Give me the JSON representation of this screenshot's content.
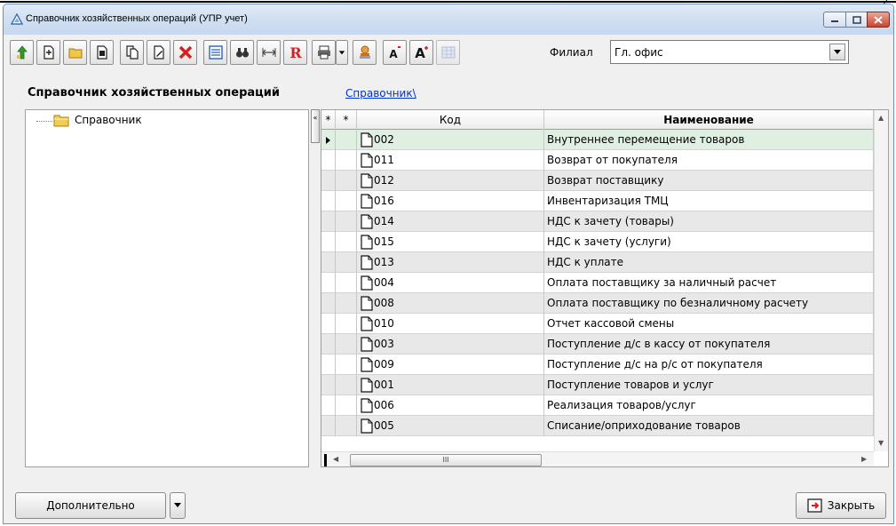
{
  "window": {
    "title": "Справочник хозяйственных операций (УПР учет)",
    "frame_number": "2"
  },
  "toolbar": {
    "buttons": [
      "up-arrow-icon",
      "new-item-icon",
      "new-folder-icon",
      "save-copy-icon",
      "copy-icon",
      "edit-icon",
      "delete-icon",
      "list-icon",
      "binoculars-icon",
      "expand-icon",
      "report-icon",
      "print-icon",
      "dropdown-icon",
      "stamp-icon",
      "font-decrease-icon",
      "font-increase-icon",
      "grid-icon"
    ],
    "filial_label": "Филиал",
    "filial_value": "Гл. офис"
  },
  "header": {
    "title": "Справочник хозяйственных операций",
    "breadcrumb": "Справочник\\"
  },
  "tree": {
    "root_label": "Справочник"
  },
  "grid": {
    "columns": [
      "*",
      "*",
      "Код",
      "Наименование"
    ],
    "rows": [
      {
        "code": "002",
        "name": "Внутреннее перемещение товаров"
      },
      {
        "code": "011",
        "name": "Возврат от покупателя"
      },
      {
        "code": "012",
        "name": "Возврат поставщику"
      },
      {
        "code": "016",
        "name": "Инвентаризация ТМЦ"
      },
      {
        "code": "014",
        "name": "НДС к зачету (товары)"
      },
      {
        "code": "015",
        "name": "НДС к зачету (услуги)"
      },
      {
        "code": "013",
        "name": "НДС к уплате"
      },
      {
        "code": "004",
        "name": "Оплата поставщику за наличный расчет"
      },
      {
        "code": "008",
        "name": "Оплата поставщику по безналичному расчету"
      },
      {
        "code": "010",
        "name": "Отчет кассовой смены"
      },
      {
        "code": "003",
        "name": "Поступление д/с в кассу от покупателя"
      },
      {
        "code": "009",
        "name": "Поступление д/с на р/с от покупателя"
      },
      {
        "code": "001",
        "name": "Поступление товаров и услуг"
      },
      {
        "code": "006",
        "name": "Реализация товаров/услуг"
      },
      {
        "code": "005",
        "name": "Списание/оприходование  товаров"
      }
    ],
    "scroll_thumb": "III"
  },
  "footer": {
    "more_label": "Дополнительно",
    "close_label": "Закрыть"
  },
  "colors": {
    "selected_row": "#dff0e3",
    "alt_row": "#e8e8e8",
    "link": "#0033cc",
    "close_red": "#c9452f"
  }
}
